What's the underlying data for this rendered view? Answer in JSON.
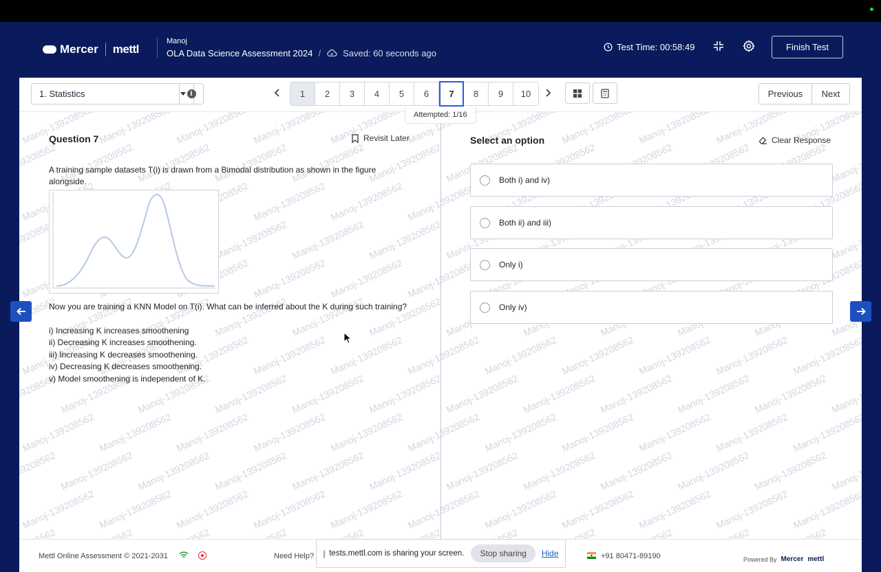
{
  "header": {
    "brand_name": "Mercer",
    "brand_mettl": "mettl",
    "user": "Manoj",
    "test_title": "OLA Data Science Assessment 2024",
    "separator": "/",
    "saved": "Saved: 60 seconds ago",
    "timer_label": "Test Time: 00:58:49",
    "finish_label": "Finish Test"
  },
  "toolbar": {
    "section": "1. Statistics",
    "info_label": "i",
    "pages": [
      "1",
      "2",
      "3",
      "4",
      "5",
      "6",
      "7",
      "8",
      "9",
      "10"
    ],
    "current_page": "7",
    "attempted": "Attempted: 1/16",
    "previous_label": "Previous",
    "next_label": "Next"
  },
  "question": {
    "title": "Question 7",
    "revisit": "Revisit Later",
    "text1": "A training sample datasets T(i) is drawn from a Bimodal distribution as shown in the figure alongside.",
    "text2": "Now you are training a KNN Model on T(i). What can be inferred about the K during such training?",
    "statements": [
      "i) Increasing K increases smoothening",
      "ii) Decreasing K increases smoothening.",
      "iii) Increasing K decreases smoothening.",
      "iv) Decreasing K decreases smoothening.",
      "v) Model smoothening is independent of K."
    ]
  },
  "answer": {
    "title": "Select an option",
    "clear": "Clear Response",
    "options": [
      "Both i) and iv)",
      "Both ii) and iii)",
      "Only i)",
      "Only iv)"
    ]
  },
  "watermark": "Manoj-139208562",
  "footer": {
    "copyright": "Mettl Online Assessment © 2021-2031",
    "need_help": "Need Help?",
    "phone": "+91 80471-89190",
    "powered_by": "Powered By",
    "powered_brand": "Mercer",
    "powered_mettl": "mettl"
  },
  "share_bar": {
    "message": "tests.mettl.com is sharing your screen.",
    "stop": "Stop sharing",
    "hide": "Hide"
  },
  "colors": {
    "header_bg": "#0a1a5c",
    "accent": "#2d5bd8",
    "arrow_bg": "#1e4fbf"
  }
}
